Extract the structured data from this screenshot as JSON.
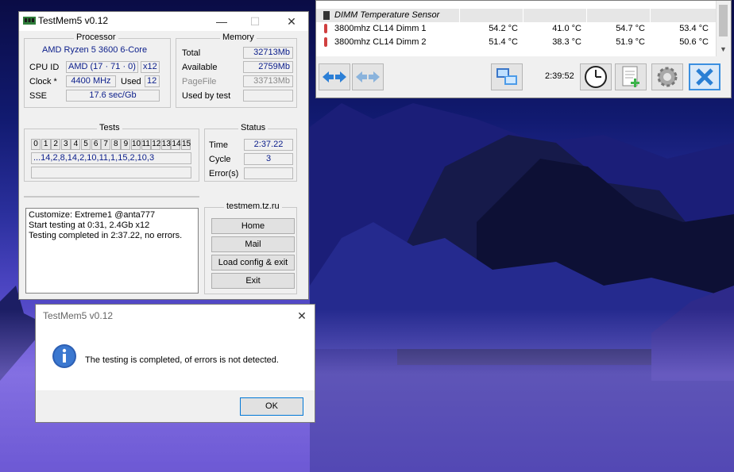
{
  "testmem": {
    "title": "TestMem5 v0.12",
    "processor": {
      "group_title": "Processor",
      "name": "AMD Ryzen 5 3600 6-Core",
      "cpu_id_label": "CPU ID",
      "cpu_id_value": "AMD  (17 · 71 · 0)",
      "threads": "x12",
      "clock_label": "Clock *",
      "clock_value": "4400 MHz",
      "used_label": "Used",
      "used_value": "12",
      "sse_label": "SSE",
      "sse_value": "17.6 sec/Gb"
    },
    "memory": {
      "group_title": "Memory",
      "total_label": "Total",
      "total_value": "32713Mb",
      "available_label": "Available",
      "available_value": "2759Mb",
      "pagefile_label": "PageFile",
      "pagefile_value": "33713Mb",
      "usedbytest_label": "Used by test",
      "usedbytest_value": ""
    },
    "tests": {
      "group_title": "Tests",
      "cells": [
        "0",
        "1",
        "2",
        "3",
        "4",
        "5",
        "6",
        "7",
        "8",
        "9",
        "10",
        "11",
        "12",
        "13",
        "14",
        "15"
      ],
      "sequence": "...14,2,8,14,2,10,11,1,15,2,10,3"
    },
    "status": {
      "group_title": "Status",
      "time_label": "Time",
      "time_value": "2:37.22",
      "cycle_label": "Cycle",
      "cycle_value": "3",
      "errors_label": "Error(s)",
      "errors_value": ""
    },
    "log": [
      "Customize: Extreme1 @anta777",
      "Start testing at 0:31, 2.4Gb x12",
      "Testing completed in 2:37.22, no errors."
    ],
    "links": {
      "group_title": "testmem.tz.ru",
      "home": "Home",
      "mail": "Mail",
      "load_config": "Load config & exit",
      "exit": "Exit"
    }
  },
  "dialog": {
    "title": "TestMem5 v0.12",
    "message": "The testing is completed, of errors is not detected.",
    "ok": "OK",
    "icon": "info-icon"
  },
  "hwinfo": {
    "sensor_header": "DIMM Temperature Sensor",
    "rows": [
      {
        "name": "3800mhz CL14 Dimm 1",
        "v1": "54.2 °C",
        "v2": "41.0 °C",
        "v3": "54.7 °C",
        "v4": "53.4 °C"
      },
      {
        "name": "3800mhz CL14 Dimm 2",
        "v1": "51.4 °C",
        "v2": "38.3 °C",
        "v3": "51.9 °C",
        "v4": "50.6 °C"
      }
    ],
    "elapsed": "2:39:52",
    "icons": [
      "arrows-left-right-icon",
      "arrows-disabled-icon",
      "network-icon",
      "clock-icon",
      "report-add-icon",
      "gear-icon",
      "close-x-icon"
    ]
  }
}
